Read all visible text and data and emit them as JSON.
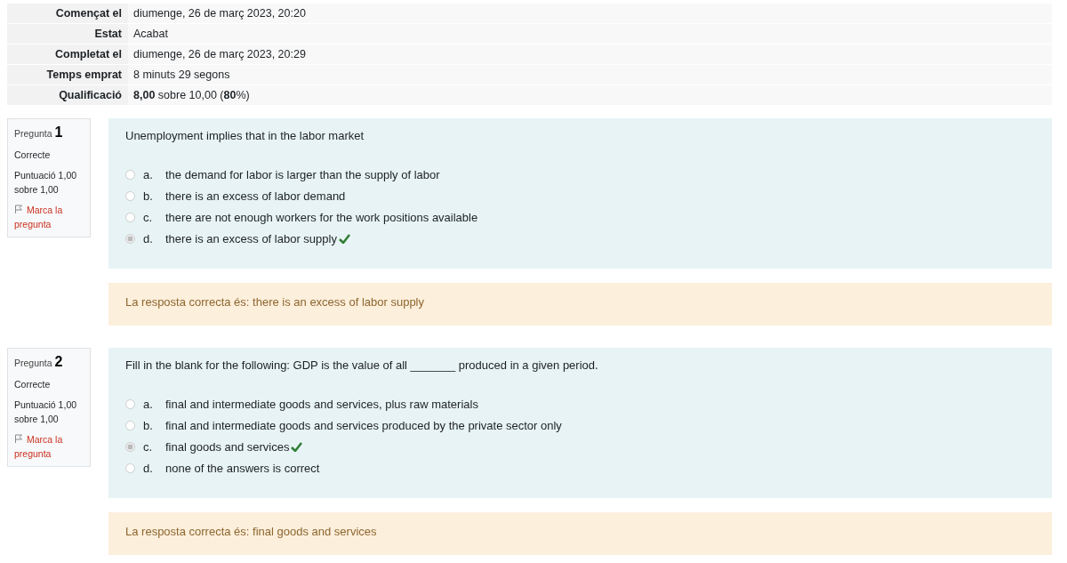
{
  "summary": [
    {
      "label": "Començat el",
      "value": "diumenge, 26 de març 2023, 20:20"
    },
    {
      "label": "Estat",
      "value": "Acabat"
    },
    {
      "label": "Completat el",
      "value": "diumenge, 26 de març 2023, 20:29"
    },
    {
      "label": "Temps emprat",
      "value": "8 minuts 29 segons"
    },
    {
      "label": "Qualificació",
      "value": "**8,00** sobre 10,00 (**80**%)"
    }
  ],
  "questions": [
    {
      "label": "Pregunta",
      "number": "1",
      "state": "Correcte",
      "score": "Puntuació 1,00 sobre 1,00",
      "flag": "Marca la pregunta",
      "text": "Unemployment implies that in the labor market",
      "answers": [
        {
          "letter": "a.",
          "text": "the demand for labor is larger than the supply of labor",
          "selected": false,
          "correct": false
        },
        {
          "letter": "b.",
          "text": "there is an excess of labor demand",
          "selected": false,
          "correct": false
        },
        {
          "letter": "c.",
          "text": "there are not enough workers for the work positions available",
          "selected": false,
          "correct": false
        },
        {
          "letter": "d.",
          "text": "there is an excess of labor supply",
          "selected": true,
          "correct": true
        }
      ],
      "feedback": "La resposta correcta és: there is an excess of labor supply"
    },
    {
      "label": "Pregunta",
      "number": "2",
      "state": "Correcte",
      "score": "Puntuació 1,00 sobre 1,00",
      "flag": "Marca la pregunta",
      "text": "Fill in the blank for the following: GDP is the value of all _______ produced in a given period.",
      "answers": [
        {
          "letter": "a.",
          "text": "final and intermediate goods and services, plus raw materials",
          "selected": false,
          "correct": false
        },
        {
          "letter": "b.",
          "text": "final and intermediate goods and services produced by the private sector only",
          "selected": false,
          "correct": false
        },
        {
          "letter": "c.",
          "text": "final goods and services",
          "selected": true,
          "correct": true
        },
        {
          "letter": "d.",
          "text": "none of the answers is correct",
          "selected": false,
          "correct": false
        }
      ],
      "feedback": "La resposta correcta és: final goods and services"
    }
  ]
}
